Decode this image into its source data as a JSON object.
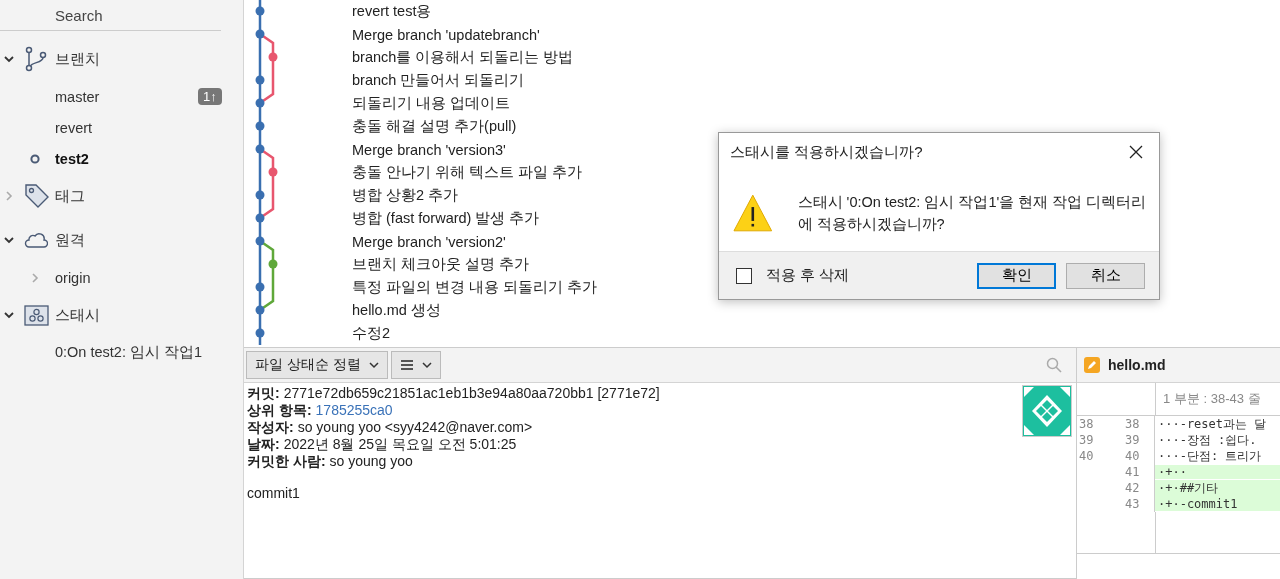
{
  "sidebar": {
    "search_label": "Search",
    "sections": [
      {
        "kind": "branch",
        "label": "브랜치",
        "expanded": true,
        "items": [
          {
            "label": "master",
            "current": false,
            "expandable": false,
            "badge": "1↑"
          },
          {
            "label": "revert",
            "current": false,
            "expandable": false
          },
          {
            "label": "test2",
            "current": true,
            "expandable": false
          }
        ]
      },
      {
        "kind": "tag",
        "label": "태그",
        "expanded": false
      },
      {
        "kind": "remote",
        "label": "원격",
        "expanded": true,
        "items": [
          {
            "label": "origin",
            "current": false,
            "expandable": true
          }
        ]
      },
      {
        "kind": "stash",
        "label": "스태시",
        "expanded": true,
        "items": [
          {
            "label": "0:On test2: 임시 작업1",
            "current": false,
            "expandable": false
          }
        ]
      }
    ]
  },
  "commits": [
    {
      "message": "revert test용",
      "kind": "main",
      "color": "#3a6fb0"
    },
    {
      "message": "Merge branch 'updatebranch'",
      "kind": "main",
      "color": "#3a6fb0"
    },
    {
      "message": "branch를 이용해서 되돌리는 방법",
      "kind": "side",
      "color": "#e8566e"
    },
    {
      "message": "branch 만들어서 되돌리기",
      "kind": "main",
      "color": "#3a6fb0"
    },
    {
      "message": "되돌리기 내용 업데이트",
      "kind": "main",
      "color": "#3a6fb0"
    },
    {
      "message": "충돌 해결 설명 추가(pull)",
      "kind": "main",
      "color": "#3a6fb0"
    },
    {
      "message": "Merge branch 'version3'",
      "kind": "main",
      "color": "#3a6fb0"
    },
    {
      "message": "충돌 안나기 위해 텍스트 파일 추가",
      "kind": "side",
      "color": "#e8566e"
    },
    {
      "message": "병합 상황2 추가",
      "kind": "main",
      "color": "#3a6fb0"
    },
    {
      "message": "병합 (fast forward) 발생 추가",
      "kind": "main",
      "color": "#3a6fb0"
    },
    {
      "message": "Merge branch 'version2'",
      "kind": "main",
      "color": "#3a6fb0"
    },
    {
      "message": "브랜치 체크아웃 설명 추가",
      "kind": "side",
      "color": "#5fa83a"
    },
    {
      "message": "특정 파일의 변경 내용 되돌리기 추가",
      "kind": "main",
      "color": "#3a6fb0"
    },
    {
      "message": "hello.md 생성",
      "kind": "main",
      "color": "#3a6fb0"
    },
    {
      "message": "수정2",
      "kind": "main",
      "color": "#3a6fb0"
    }
  ],
  "toolbar": {
    "sort_button": "파일 상태순 정렬"
  },
  "details": {
    "fields": [
      {
        "label": "커밋:",
        "value": "2771e72db659c21851ac1eb1b3e94a80aa720bb1 [2771e72]",
        "kind": "text"
      },
      {
        "label": "상위 항목:",
        "value": "1785255ca0",
        "kind": "link"
      },
      {
        "label": "작성자:",
        "value": "so young yoo <syy4242@naver.com>",
        "kind": "text"
      },
      {
        "label": "날짜:",
        "value": "2022년 8월 25일 목요일 오전 5:01:25",
        "kind": "text"
      },
      {
        "label": "커밋한 사람:",
        "value": "so young yoo",
        "kind": "text"
      }
    ],
    "message": "commit1"
  },
  "diff": {
    "file": "hello.md",
    "hunk_header": "1 부분 : 38-43 줄",
    "lines": [
      {
        "old": "38",
        "new": "38",
        "text": "···-reset과는 달",
        "kind": "context"
      },
      {
        "old": "39",
        "new": "39",
        "text": "···-장점 :쉽다.",
        "kind": "context"
      },
      {
        "old": "40",
        "new": "40",
        "text": "···-단점: 트리가",
        "kind": "context"
      },
      {
        "new": "41",
        "text": "·+··",
        "kind": "added"
      },
      {
        "new": "42",
        "text": "·+·##기타",
        "kind": "added"
      },
      {
        "new": "43",
        "text": "·+·-commit1",
        "kind": "added"
      }
    ]
  },
  "dialog": {
    "title": "스태시를 적용하시겠습니까?",
    "message": "스태시 '0:On test2: 임시 작업1'을 현재 작업 디렉터리에 적용하시겠습니까?",
    "checkbox": {
      "label": "적용 후 삭제",
      "checked": false
    },
    "buttons": [
      {
        "label": "확인",
        "default": true
      },
      {
        "label": "취소",
        "default": false
      }
    ]
  }
}
